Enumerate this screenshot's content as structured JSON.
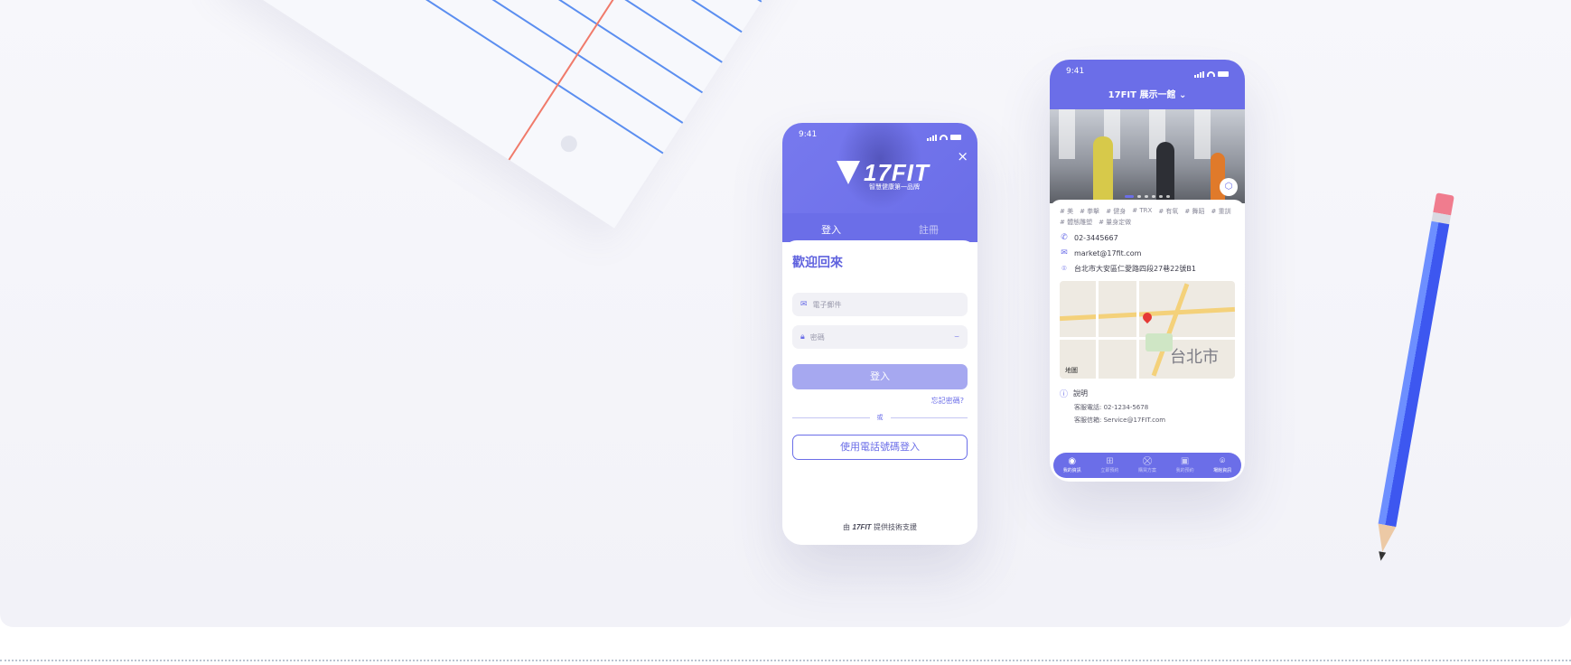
{
  "login_phone": {
    "time": "9:41",
    "brand": "17FIT",
    "slogan": "智慧健康第一品牌",
    "close_icon": "×",
    "tabs": [
      {
        "label": "登入",
        "active": true
      },
      {
        "label": "註冊",
        "active": false
      }
    ],
    "welcome": "歡迎回來",
    "email_placeholder": "電子郵件",
    "password_placeholder": "密碼",
    "login_button": "登入",
    "forgot": "忘記密碼?",
    "or": "或",
    "phone_login_button": "使用電話號碼登入",
    "powered_prefix": "由",
    "powered_brand": "17FIT",
    "powered_suffix": "提供技術支援"
  },
  "gym_phone": {
    "time": "9:41",
    "title": "17FIT 展示一館",
    "title_chevron": "⌄",
    "tags": [
      "# 美",
      "# 拳擊",
      "# 健身",
      "# TRX",
      "# 有氧",
      "# 舞蹈",
      "# 重訓",
      "# 體態雕塑",
      "# 量身定做"
    ],
    "phone": "02-3445667",
    "email": "market@17fit.com",
    "address": "台北市大安區仁愛路四段27巷22號B1",
    "map_city": "台北市",
    "map_brand": "地圖",
    "desc_title": "說明",
    "desc_lines": [
      "客服電話:  02-1234-5678",
      "客服信箱:  Service@17FIT.com"
    ],
    "nav": [
      {
        "label": "我的資訊",
        "icon": "user-icon",
        "glyph": "◉",
        "active": true
      },
      {
        "label": "立即預約",
        "icon": "plus-icon",
        "glyph": "⊞",
        "active": false
      },
      {
        "label": "購買方案",
        "icon": "cart-icon",
        "glyph": "⛒",
        "active": false
      },
      {
        "label": "我的預約",
        "icon": "calendar-icon",
        "glyph": "▣",
        "active": false
      },
      {
        "label": "場館資訊",
        "icon": "location-icon",
        "glyph": "⌾",
        "active": true
      }
    ]
  },
  "colors": {
    "primary": "#6b6ee8",
    "primary_disabled": "#a6a8f0",
    "background": "#f4f4f9"
  }
}
